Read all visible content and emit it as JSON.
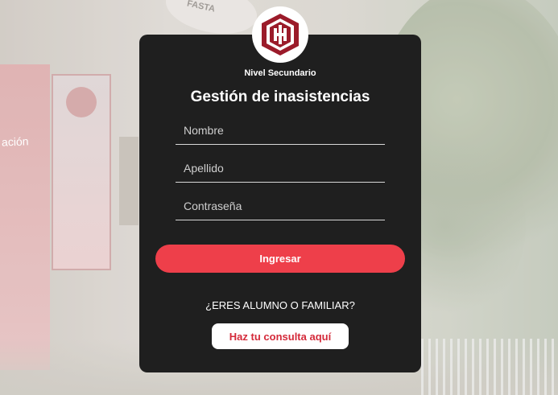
{
  "background": {
    "banner_text": "ación",
    "sign_text": "FASTA"
  },
  "header": {
    "subtitle": "Nivel Secundario",
    "title": "Gestión de inasistencias"
  },
  "form": {
    "nombre_placeholder": "Nombre",
    "apellido_placeholder": "Apellido",
    "password_placeholder": "Contraseña",
    "login_label": "Ingresar"
  },
  "footer": {
    "question": "¿ERES ALUMNO O FAMILIAR?",
    "consulta_label": "Haz tu consulta aquí"
  },
  "colors": {
    "card": "#1f1f1f",
    "accent": "#ee3f4a",
    "consulta_text": "#d42a3a",
    "logo_mark": "#9b1b2a"
  }
}
